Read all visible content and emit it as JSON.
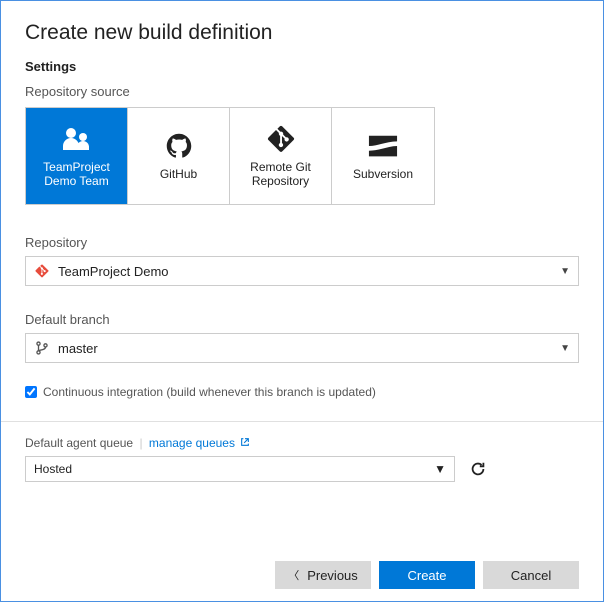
{
  "title": "Create new build definition",
  "settings_label": "Settings",
  "repo_source_label": "Repository source",
  "sources": [
    {
      "id": "team-project",
      "label": "TeamProject Demo Team",
      "selected": true
    },
    {
      "id": "github",
      "label": "GitHub",
      "selected": false
    },
    {
      "id": "remote-git",
      "label": "Remote Git Repository",
      "selected": false
    },
    {
      "id": "subversion",
      "label": "Subversion",
      "selected": false
    }
  ],
  "repository_label": "Repository",
  "repository_value": "TeamProject Demo",
  "branch_label": "Default branch",
  "branch_value": "master",
  "ci_label": "Continuous integration (build whenever this branch is updated)",
  "ci_checked": true,
  "queue_label": "Default agent queue",
  "queue_separator": "|",
  "manage_queues_label": "manage queues",
  "queue_value": "Hosted",
  "buttons": {
    "previous": "Previous",
    "create": "Create",
    "cancel": "Cancel"
  }
}
